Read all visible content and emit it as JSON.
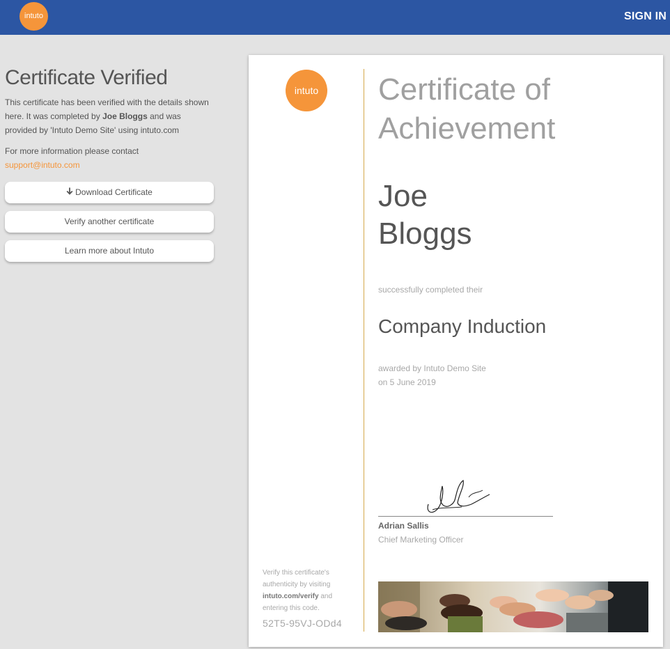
{
  "header": {
    "logo_text": "intuto",
    "sign_in_label": "SIGN IN"
  },
  "sidebar": {
    "heading": "Certificate Verified",
    "desc_part1": "This certificate has been verified with the details shown here. It was completed by ",
    "desc_name": "Joe Bloggs",
    "desc_part2": " and was provided by 'Intuto Demo Site' using intuto.com",
    "contact_text": "For more information please contact ",
    "contact_email": "support@intuto.com",
    "buttons": {
      "download": "Download Certificate",
      "verify_another": "Verify another certificate",
      "learn_more": "Learn more about Intuto"
    }
  },
  "certificate": {
    "logo_text": "intuto",
    "title_line1": "Certificate of",
    "title_line2": "Achievement",
    "first_name": "Joe",
    "last_name": "Bloggs",
    "completed_text": "successfully completed their",
    "course_name": "Company Induction",
    "awarded_by": "awarded by Intuto Demo Site",
    "awarded_on": "on 5 June 2019",
    "signatory_name": "Adrian Sallis",
    "signatory_title": "Chief Marketing Officer",
    "verify_part1": "Verify this certificate's authenticity by visiting ",
    "verify_link": "intuto.com/verify",
    "verify_part2": " and entering this code.",
    "code": "52T5-95VJ-ODd4"
  },
  "colors": {
    "header_bg": "#2c56a3",
    "accent_orange": "#f5953a",
    "gold_line": "#d4a84a",
    "page_bg": "#e3e3e3"
  }
}
